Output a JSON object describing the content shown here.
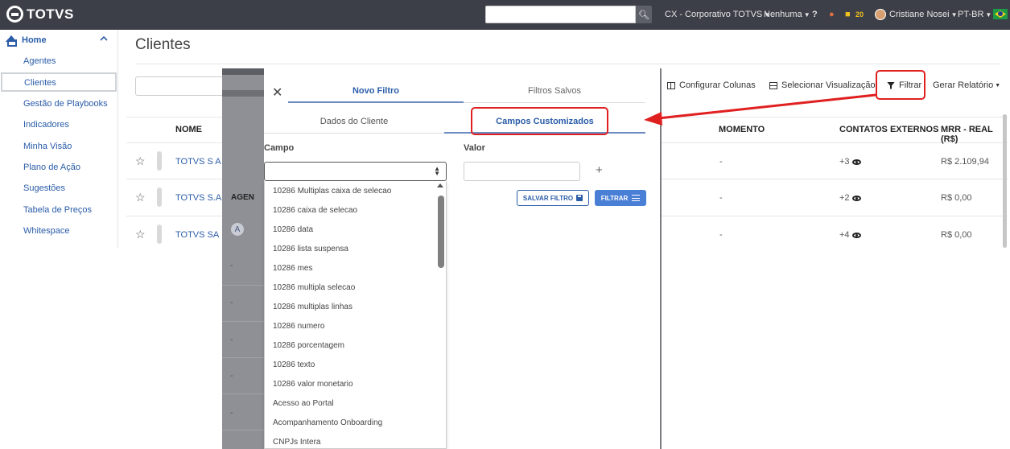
{
  "topbar": {
    "brand": "TOTVS",
    "search_placeholder": "",
    "company": "CX - Corporativo TOTVS",
    "context": "Nenhuma",
    "notification_count": "20",
    "user_name": "Cristiane Nosei",
    "language": "PT-BR"
  },
  "sidebar": {
    "section": "Home",
    "items": [
      {
        "label": "Agentes"
      },
      {
        "label": "Clientes"
      },
      {
        "label": "Gestão de Playbooks"
      },
      {
        "label": "Indicadores"
      },
      {
        "label": "Minha Visão"
      },
      {
        "label": "Plano de Ação"
      },
      {
        "label": "Sugestões"
      },
      {
        "label": "Tabela de Preços"
      },
      {
        "label": "Whitespace"
      }
    ]
  },
  "main": {
    "title": "Clientes",
    "toolbar": {
      "configure_columns": "Configurar Colunas",
      "select_view": "Selecionar Visualização",
      "filter": "Filtrar",
      "report": "Gerar Relatório"
    },
    "table": {
      "headers": {
        "name": "NOME",
        "agent": "AGEN",
        "moment": "MOMENTO",
        "contacts": "CONTATOS EXTERNOS",
        "mrr": "MRR - REAL (R$)"
      },
      "rows": [
        {
          "name": "TOTVS S A",
          "moment": "-",
          "contacts": "+3",
          "mrr": "R$ 2.109,94"
        },
        {
          "name": "TOTVS S.A.",
          "moment": "-",
          "contacts": "+2",
          "mrr": "R$ 0,00"
        },
        {
          "name": "TOTVS SA",
          "agent_initial": "A",
          "moment": "-",
          "contacts": "+4",
          "mrr": "R$ 0,00"
        }
      ],
      "placeholder_dash": "-"
    }
  },
  "modal": {
    "tabs": {
      "new": "Novo Filtro",
      "saved": "Filtros Salvos"
    },
    "subtabs": {
      "client": "Dados do Cliente",
      "custom": "Campos Customizados"
    },
    "field_label": "Campo",
    "value_label": "Valor",
    "save_button": "SALVAR FILTRO",
    "filter_button": "FILTRAR",
    "options": [
      "10286 Multiplas caixa de selecao",
      "10286 caixa de selecao",
      "10286 data",
      "10286 lista suspensa",
      "10286 mes",
      "10286 multipla selecao",
      "10286 multiplas linhas",
      "10286 numero",
      "10286 porcentagem",
      "10286 texto",
      "10286 valor monetario",
      "Acesso ao Portal",
      "Acompanhamento Onboarding",
      "CNPJs Intera"
    ]
  },
  "colors": {
    "topbar": "#3c3f47",
    "accent": "#2a5ca8",
    "annotation": "#e02020"
  }
}
